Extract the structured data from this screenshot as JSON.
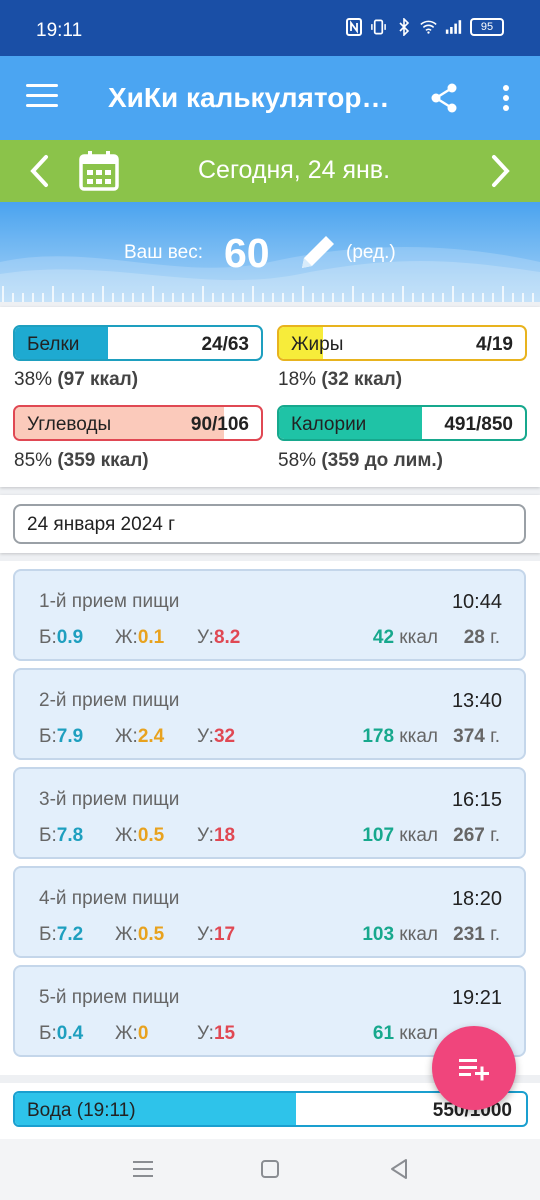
{
  "status": {
    "time": "19:11",
    "battery": "95"
  },
  "app": {
    "title": "ХиКи калькулятор…"
  },
  "date_nav": {
    "label": "Сегодня, 24 янв."
  },
  "weight": {
    "label": "Ваш вес:",
    "value": "60",
    "edit_label": "(ред.)"
  },
  "macros": {
    "protein": {
      "label": "Белки",
      "value": "24/63",
      "fraction": 0.38,
      "summary_pct": "38%",
      "summary_detail": "(97 ккал)"
    },
    "fat": {
      "label": "Жиры",
      "value": "4/19",
      "fraction": 0.18,
      "summary_pct": "18%",
      "summary_detail": "(32 ккал)"
    },
    "carbs": {
      "label": "Углеводы",
      "value": "90/106",
      "fraction": 0.85,
      "summary_pct": "85%",
      "summary_detail": "(359 ккал)"
    },
    "calories": {
      "label": "Калории",
      "value": "491/850",
      "fraction": 0.58,
      "summary_pct": "58%",
      "summary_detail": "(359 до лим.)"
    }
  },
  "day_field": {
    "value": "24 января 2024 г"
  },
  "meals": [
    {
      "name": "1-й прием пищи",
      "time": "10:44",
      "p_label": "Б:",
      "p": "0.9",
      "f_label": "Ж:",
      "f": "0.1",
      "c_label": "У:",
      "c": "8.2",
      "kcal": "42",
      "kcal_unit": "ккал",
      "grams": "28",
      "grams_unit": "г."
    },
    {
      "name": "2-й прием пищи",
      "time": "13:40",
      "p_label": "Б:",
      "p": "7.9",
      "f_label": "Ж:",
      "f": "2.4",
      "c_label": "У:",
      "c": "32",
      "kcal": "178",
      "kcal_unit": "ккал",
      "grams": "374",
      "grams_unit": "г."
    },
    {
      "name": "3-й прием пищи",
      "time": "16:15",
      "p_label": "Б:",
      "p": "7.8",
      "f_label": "Ж:",
      "f": "0.5",
      "c_label": "У:",
      "c": "18",
      "kcal": "107",
      "kcal_unit": "ккал",
      "grams": "267",
      "grams_unit": "г."
    },
    {
      "name": "4-й прием пищи",
      "time": "18:20",
      "p_label": "Б:",
      "p": "7.2",
      "f_label": "Ж:",
      "f": "0.5",
      "c_label": "У:",
      "c": "17",
      "kcal": "103",
      "kcal_unit": "ккал",
      "grams": "231",
      "grams_unit": "г."
    },
    {
      "name": "5-й прием пищи",
      "time": "19:21",
      "p_label": "Б:",
      "p": "0.4",
      "f_label": "Ж:",
      "f": "0",
      "c_label": "У:",
      "c": "15",
      "kcal": "61",
      "kcal_unit": "ккал"
    }
  ],
  "water": {
    "label": "Вода (19:11)",
    "value": "550/1000",
    "fraction": 0.55
  },
  "colors": {
    "status_bar": "#1a4fa6",
    "app_bar": "#4ba5f2",
    "date_bar": "#8bc34a",
    "protein": "#1e9fbf",
    "fat": "#e8a21e",
    "carbs": "#e04853",
    "calories": "#17a88d",
    "fab": "#f0457c",
    "water": "#2ec3ea"
  },
  "icons": [
    "menu-icon",
    "share-icon",
    "more-vert-icon",
    "chevron-left-icon",
    "calendar-icon",
    "chevron-right-icon",
    "pencil-icon",
    "add-list-icon",
    "nav-menu-icon",
    "nav-home-icon",
    "nav-back-icon"
  ]
}
